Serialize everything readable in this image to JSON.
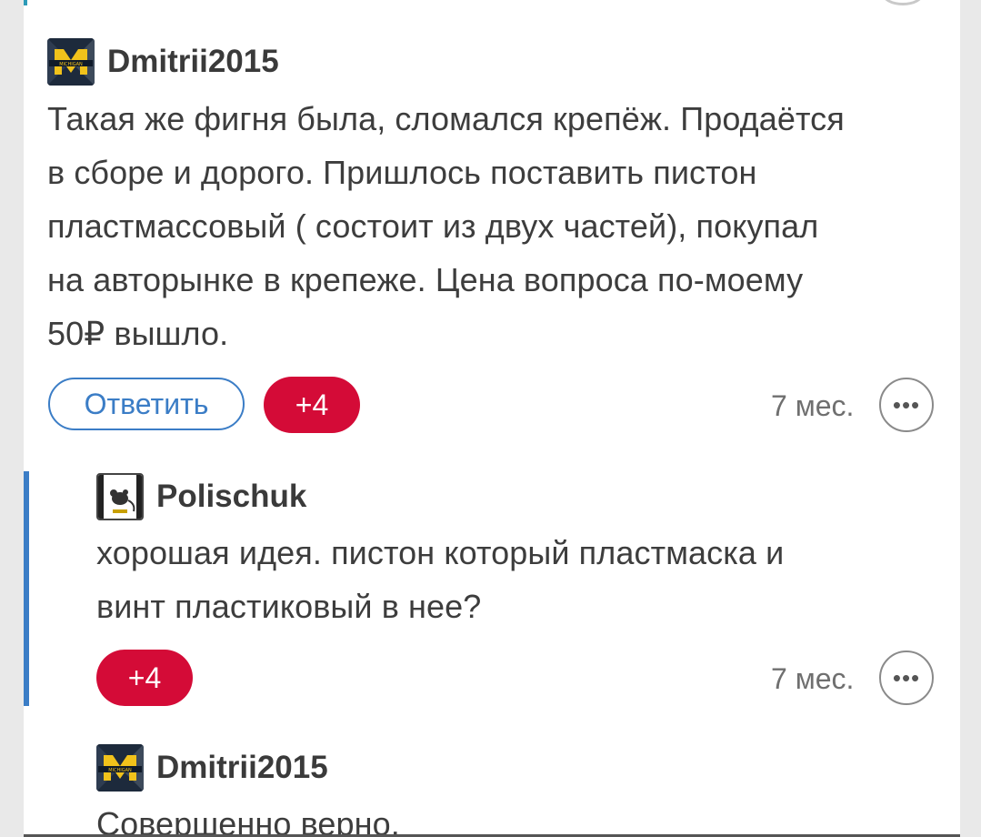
{
  "comments": [
    {
      "username": "Dmitrii2015",
      "lines": [
        "Такая же фигня была, сломался крепёж. Продаётся",
        "в сборе и дорого. Пришлось поставить пистон",
        "пластмассовый ( состоит из двух частей), покупал",
        "на авторынке в крепеже. Цена вопроса по-моему",
        "50₽ вышло."
      ],
      "reply_label": "Ответить",
      "votes": "+4",
      "time": "7 мес.",
      "more_icon": "ellipsis-icon"
    },
    {
      "username": "Polischuk",
      "lines": [
        "хорошая идея. пистон который пластмаска и",
        "винт пластиковый в нее?"
      ],
      "votes": "+4",
      "time": "7 мес.",
      "more_icon": "ellipsis-icon"
    },
    {
      "username": "Dmitrii2015",
      "lines": [
        "Совершенно верно."
      ]
    }
  ],
  "avatar_michigan_text": "MICHIGAN",
  "colors": {
    "accent_blue": "#3b7dc6",
    "vote_red": "#d40b37",
    "text": "#3d3d3d",
    "muted": "#6f6f6f"
  }
}
